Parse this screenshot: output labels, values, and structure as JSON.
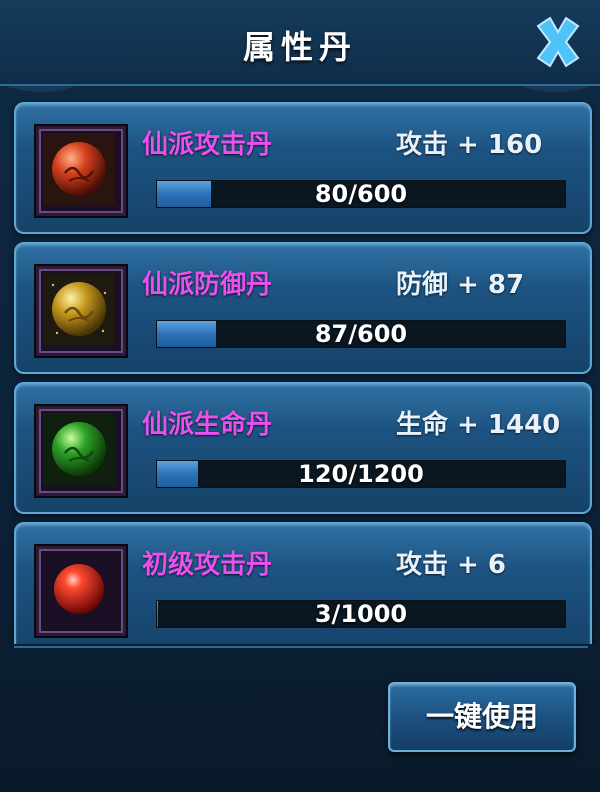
{
  "panel": {
    "title": "属性丹",
    "close_icon": "close-x-icon"
  },
  "pills": [
    {
      "name": "仙派攻击丹",
      "stat": "攻击 + 160",
      "progress": "80/600",
      "current": 80,
      "max": 600,
      "icon": "red-orb-pill-icon",
      "color": "#c9341c"
    },
    {
      "name": "仙派防御丹",
      "stat": "防御 + 87",
      "progress": "87/600",
      "current": 87,
      "max": 600,
      "icon": "gold-orb-pill-icon",
      "color": "#c99a1f"
    },
    {
      "name": "仙派生命丹",
      "stat": "生命 + 1440",
      "progress": "120/1200",
      "current": 120,
      "max": 1200,
      "icon": "green-orb-pill-icon",
      "color": "#2fa12a"
    },
    {
      "name": "初级攻击丹",
      "stat": "攻击 + 6",
      "progress": "3/1000",
      "current": 3,
      "max": 1000,
      "icon": "red-sphere-pill-icon",
      "color": "#e0201a"
    }
  ],
  "footer": {
    "use_all_label": "一键使用"
  },
  "colors": {
    "name_text": "#ea4ff0",
    "accent_border": "#5ea6d4",
    "bar_fill": "#2d72b9"
  }
}
